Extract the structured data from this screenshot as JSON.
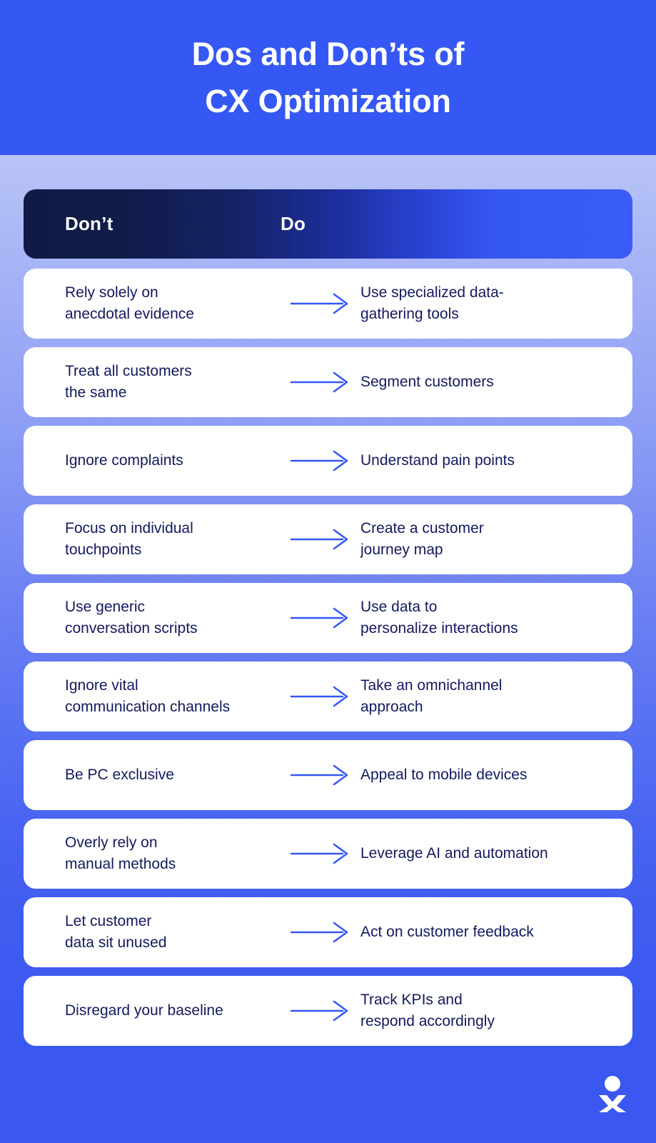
{
  "banner": {
    "title_line1": "Dos and Don’ts of",
    "title_line2": "CX Optimization"
  },
  "table": {
    "headers": {
      "dont": "Don’t",
      "do": "Do"
    },
    "rows": [
      {
        "dont": "Rely solely on\nanecdotal evidence",
        "do": "Use specialized data-\ngathering tools"
      },
      {
        "dont": "Treat all customers\nthe same",
        "do": "Segment customers"
      },
      {
        "dont": "Ignore complaints",
        "do": "Understand pain points"
      },
      {
        "dont": "Focus on individual\ntouchpoints",
        "do": "Create a customer\njourney map"
      },
      {
        "dont": "Use generic\nconversation scripts",
        "do": "Use data to\npersonalize interactions"
      },
      {
        "dont": "Ignore vital\ncommunication channels",
        "do": "Take an omnichannel\napproach"
      },
      {
        "dont": "Be PC exclusive",
        "do": "Appeal to mobile devices"
      },
      {
        "dont": "Overly rely on\nmanual methods",
        "do": "Leverage AI and automation"
      },
      {
        "dont": "Let customer\ndata sit unused",
        "do": "Act on customer feedback"
      },
      {
        "dont": "Disregard your baseline",
        "do": "Track KPIs and\nrespond accordingly"
      }
    ]
  },
  "footer": {
    "logo_icon": "person-x-logo-icon"
  },
  "colors": {
    "banner_blue": "#3558f4",
    "header_row_navy": "#101a45",
    "header_row_blue": "#3a5cf6",
    "card_white": "#ffffff",
    "text_navy": "#121a5e",
    "arrow_blue": "#3558f4",
    "background_top": "#ccd4f7",
    "background_bottom": "#3a57f0"
  }
}
